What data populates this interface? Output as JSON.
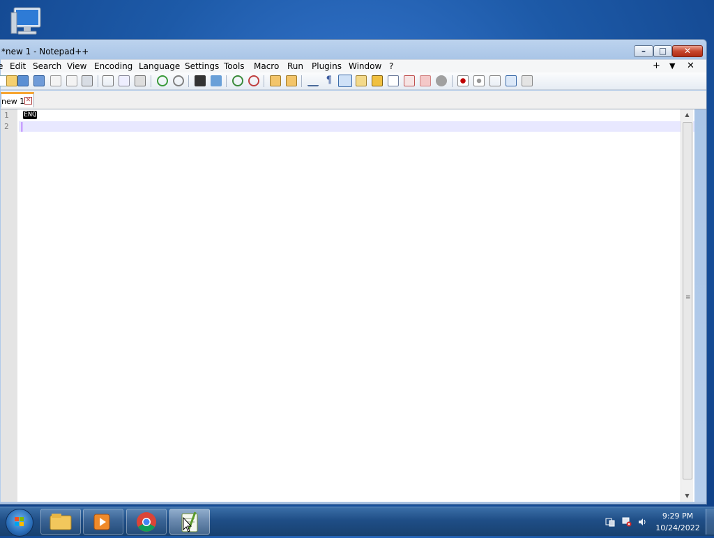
{
  "desktop": {
    "icons": [
      {
        "name": "computer-icon"
      }
    ]
  },
  "window": {
    "title": "*new 1 - Notepad++",
    "controls": {
      "minimize": "–",
      "maximize": "□",
      "close": "✕"
    }
  },
  "menubar": {
    "items": [
      "e",
      "Edit",
      "Search",
      "View",
      "Encoding",
      "Language",
      "Settings",
      "Tools",
      "Macro",
      "Run",
      "Plugins",
      "Window",
      "?"
    ],
    "right": [
      "+",
      "▼",
      "✕"
    ]
  },
  "toolbar": {
    "icons": [
      "new-file-icon",
      "open-file-icon",
      "save-icon",
      "save-all-icon",
      "close-icon",
      "close-all-icon",
      "print-icon",
      "cut-icon",
      "copy-icon",
      "paste-icon",
      "undo-icon",
      "redo-icon",
      "find-icon",
      "replace-icon",
      "zoom-in-icon",
      "zoom-out-icon",
      "sync-vertical-icon",
      "sync-horizontal-icon",
      "word-wrap-icon",
      "show-all-chars-icon",
      "indent-guide-icon",
      "udl-icon",
      "doc-map-icon",
      "function-list-icon",
      "folder-workspace-icon",
      "monitoring-icon",
      "record-macro-icon",
      "stop-record-icon",
      "playback-icon",
      "run-macro-multiple-icon",
      "save-macro-icon"
    ]
  },
  "tabs": [
    {
      "label": "new 1",
      "close": "✕"
    }
  ],
  "editor": {
    "line_numbers": [
      "1",
      "2"
    ],
    "lines": [
      "ENQ",
      ""
    ]
  },
  "taskbar": {
    "apps": [
      "file-explorer-icon",
      "media-player-icon",
      "chrome-icon",
      "notepad-plus-plus-icon"
    ],
    "clock": {
      "time": "9:29 PM",
      "date": "10/24/2022"
    }
  }
}
